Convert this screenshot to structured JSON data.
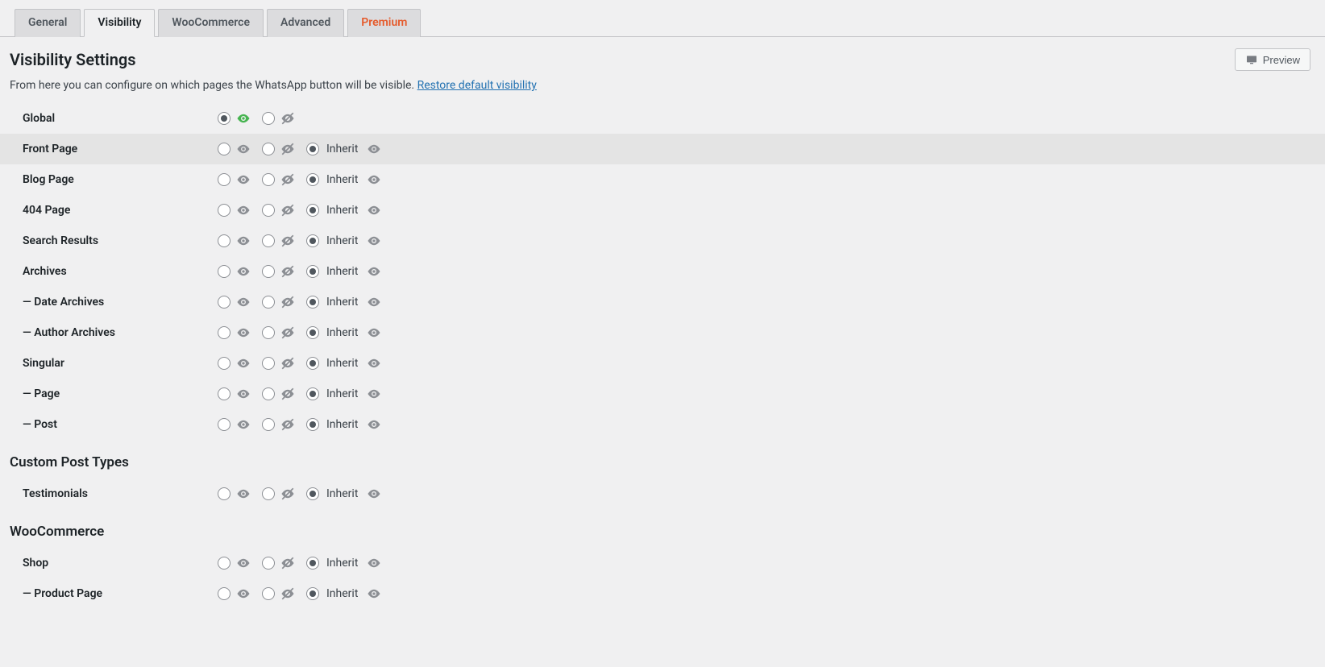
{
  "tabs": {
    "general": "General",
    "visibility": "Visibility",
    "woocommerce": "WooCommerce",
    "advanced": "Advanced",
    "premium": "Premium"
  },
  "header": {
    "title": "Visibility Settings",
    "preview_label": "Preview"
  },
  "description": {
    "text": "From here you can configure on which pages the WhatsApp button will be visible. ",
    "link": "Restore default visibility"
  },
  "inherit_label": "Inherit",
  "global": {
    "label": "Global"
  },
  "rows": [
    {
      "key": "front_page",
      "label": "Front Page",
      "highlight": true
    },
    {
      "key": "blog_page",
      "label": "Blog Page"
    },
    {
      "key": "404_page",
      "label": "404 Page"
    },
    {
      "key": "search_results",
      "label": "Search Results"
    },
    {
      "key": "archives",
      "label": "Archives"
    },
    {
      "key": "date_archives",
      "label": "Date Archives",
      "indent": true
    },
    {
      "key": "author_archives",
      "label": "Author Archives",
      "indent": true
    },
    {
      "key": "singular",
      "label": "Singular"
    },
    {
      "key": "page",
      "label": "Page",
      "indent": true
    },
    {
      "key": "post",
      "label": "Post",
      "indent": true
    }
  ],
  "section_custom": "Custom Post Types",
  "rows_custom": [
    {
      "key": "testimonials",
      "label": "Testimonials"
    }
  ],
  "section_woo": "WooCommerce",
  "rows_woo": [
    {
      "key": "shop",
      "label": "Shop"
    },
    {
      "key": "product_page",
      "label": "Product Page",
      "indent": true
    }
  ]
}
